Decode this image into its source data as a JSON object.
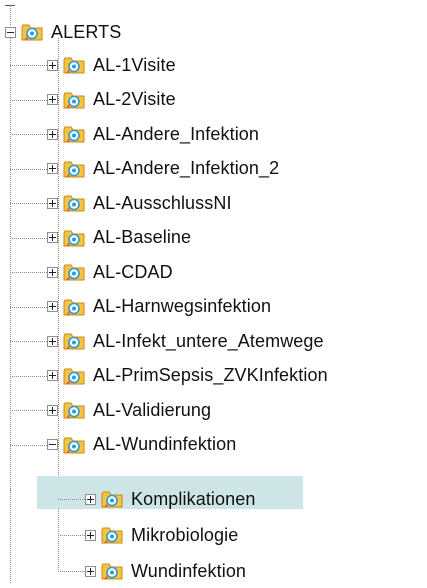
{
  "tree": {
    "root": {
      "label": "ALERTS",
      "expanded": true,
      "icon": "alert-folder-icon"
    },
    "items": [
      {
        "label": "AL-1Visite",
        "expanded": false,
        "icon": "alert-folder-icon"
      },
      {
        "label": "AL-2Visite",
        "expanded": false,
        "icon": "alert-folder-icon"
      },
      {
        "label": "AL-Andere_Infektion",
        "expanded": false,
        "icon": "alert-folder-icon"
      },
      {
        "label": "AL-Andere_Infektion_2",
        "expanded": false,
        "icon": "alert-folder-icon"
      },
      {
        "label": "AL-AusschlussNI",
        "expanded": false,
        "icon": "alert-folder-icon"
      },
      {
        "label": "AL-Baseline",
        "expanded": false,
        "icon": "alert-folder-icon"
      },
      {
        "label": "AL-CDAD",
        "expanded": false,
        "icon": "alert-folder-icon"
      },
      {
        "label": "AL-Harnwegsinfektion",
        "expanded": false,
        "icon": "alert-folder-icon"
      },
      {
        "label": "AL-Infekt_untere_Atemwege",
        "expanded": false,
        "icon": "alert-folder-icon"
      },
      {
        "label": "AL-PrimSepsis_ZVKInfektion",
        "expanded": false,
        "icon": "alert-folder-icon"
      },
      {
        "label": "AL-Validierung",
        "expanded": false,
        "icon": "alert-folder-icon"
      },
      {
        "label": "AL-Wundinfektion",
        "expanded": true,
        "selected": true,
        "icon": "alert-folder-icon"
      }
    ],
    "children": [
      {
        "label": "Komplikationen",
        "expanded": false,
        "icon": "alert-folder-icon"
      },
      {
        "label": "Mikrobiologie",
        "expanded": false,
        "icon": "alert-folder-icon"
      },
      {
        "label": "Wundinfektion",
        "expanded": false,
        "icon": "alert-folder-icon"
      }
    ]
  },
  "colors": {
    "selection": "#cde5e7",
    "folder_fill": "#f6c343",
    "folder_border": "#c98a12",
    "folder_emblem": "#2f9bd1",
    "text": "#111111"
  }
}
